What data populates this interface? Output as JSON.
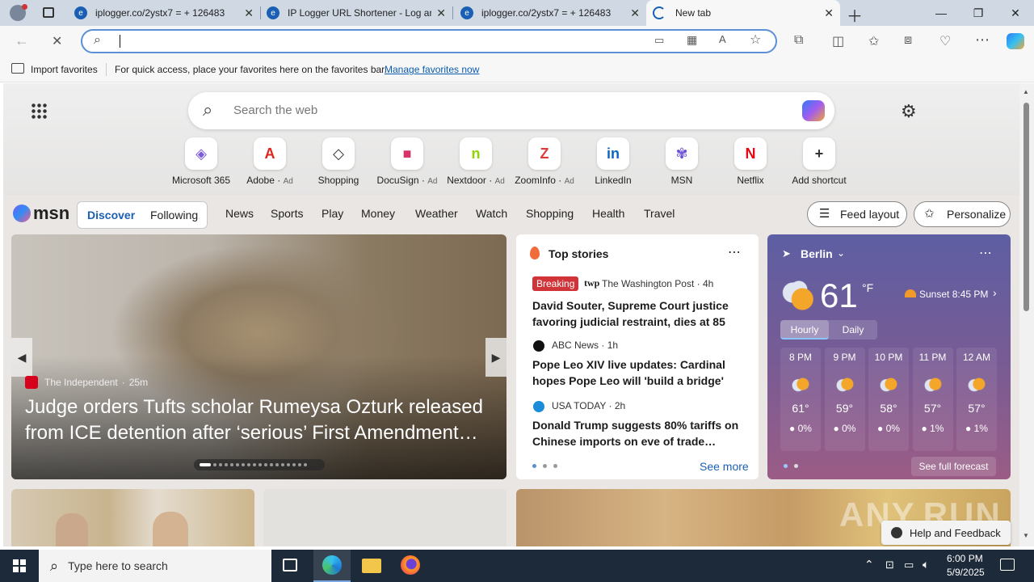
{
  "tabs": [
    {
      "title": "iplogger.co/2ystx7 = + 126483",
      "active": false
    },
    {
      "title": "IP Logger URL Shortener - Log an",
      "active": false
    },
    {
      "title": "iplogger.co/2ystx7 = + 126483",
      "active": false
    },
    {
      "title": "New tab",
      "active": true
    }
  ],
  "address": {
    "value": ""
  },
  "favorites": {
    "import_label": "Import favorites",
    "hint": "For quick access, place your favorites here on the favorites bar.",
    "manage_link": "Manage favorites now"
  },
  "ntp": {
    "search_placeholder": "Search the web",
    "shortcuts": [
      {
        "label": "Microsoft 365",
        "ad": "",
        "icon": "microsoft-365-icon",
        "color": "#7b5cd6",
        "glyph": "◈"
      },
      {
        "label": "Adobe",
        "ad": "Ad",
        "icon": "adobe-icon",
        "color": "#e1251b",
        "glyph": "A"
      },
      {
        "label": "Shopping",
        "ad": "",
        "icon": "shopping-tag-icon",
        "color": "#333333",
        "glyph": "◇"
      },
      {
        "label": "DocuSign",
        "ad": "Ad",
        "icon": "docusign-icon",
        "color": "#d6336c",
        "glyph": "■"
      },
      {
        "label": "Nextdoor",
        "ad": "Ad",
        "icon": "nextdoor-icon",
        "color": "#8ed500",
        "glyph": "n"
      },
      {
        "label": "ZoomInfo",
        "ad": "Ad",
        "icon": "zoominfo-icon",
        "color": "#e23a3a",
        "glyph": "Z"
      },
      {
        "label": "LinkedIn",
        "ad": "",
        "icon": "linkedin-icon",
        "color": "#0a66c2",
        "glyph": "in"
      },
      {
        "label": "MSN",
        "ad": "",
        "icon": "msn-icon",
        "color": "#6b4fd6",
        "glyph": "✾"
      },
      {
        "label": "Netflix",
        "ad": "",
        "icon": "netflix-icon",
        "color": "#e50914",
        "glyph": "N"
      },
      {
        "label": "Add shortcut",
        "ad": "",
        "icon": "add-icon",
        "color": "#333333",
        "glyph": "+"
      }
    ]
  },
  "msn": {
    "logo": "msn",
    "toggle": [
      "Discover",
      "Following"
    ],
    "nav": [
      "News",
      "Sports",
      "Play",
      "Money",
      "Weather",
      "Watch",
      "Shopping",
      "Health",
      "Travel"
    ],
    "feed_layout": "Feed layout",
    "personalize": "Personalize"
  },
  "hero_story": {
    "source": "The Independent",
    "age": "25m",
    "headline": "Judge orders Tufts scholar Rumeysa Ozturk released from ICE detention after ‘serious’ First Amendment…",
    "dots": 18
  },
  "top_stories": {
    "title": "Top stories",
    "items": [
      {
        "badge": "Breaking",
        "source": "The Washington Post",
        "age": "4h",
        "headline": "David Souter, Supreme Court justice favoring judicial restraint, dies at 85"
      },
      {
        "badge": "",
        "source": "ABC News",
        "age": "1h",
        "headline": "Pope Leo XIV live updates: Cardinal hopes Pope Leo will 'build a bridge' wit…"
      },
      {
        "badge": "",
        "source": "USA TODAY",
        "age": "2h",
        "headline": "Donald Trump suggests 80% tariffs on Chinese imports on eve of trade…"
      }
    ],
    "see_more": "See more"
  },
  "weather": {
    "city": "Berlin",
    "temp": "61",
    "unit": "°F",
    "sunset": "Sunset 8:45 PM",
    "tabs": [
      "Hourly",
      "Daily"
    ],
    "hours": [
      {
        "time": "8 PM",
        "temp": "61°",
        "precip": "0%"
      },
      {
        "time": "9 PM",
        "temp": "59°",
        "precip": "0%"
      },
      {
        "time": "10 PM",
        "temp": "58°",
        "precip": "0%"
      },
      {
        "time": "11 PM",
        "temp": "57°",
        "precip": "1%"
      },
      {
        "time": "12 AM",
        "temp": "57°",
        "precip": "1%"
      }
    ],
    "full_forecast": "See full forecast"
  },
  "help": "Help and Feedback",
  "watermark": "ANY.RUN",
  "taskbar": {
    "search_placeholder": "Type here to search",
    "time": "6:00 PM",
    "date": "5/9/2025"
  }
}
